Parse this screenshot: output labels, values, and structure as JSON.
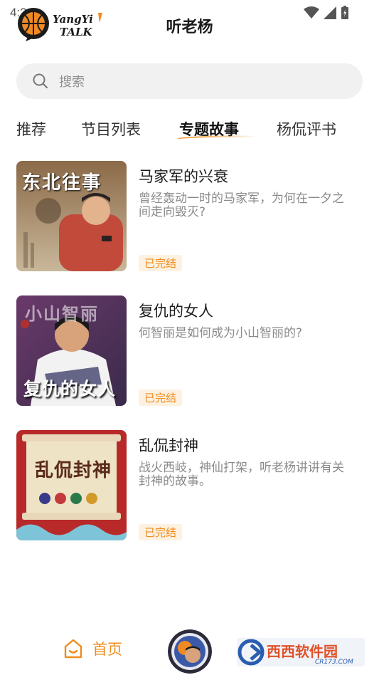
{
  "status_bar": {
    "time": "4:2"
  },
  "header": {
    "logo_text": "YangYi Talk",
    "title": "听老杨"
  },
  "search": {
    "placeholder": "搜索"
  },
  "tabs": [
    {
      "label": "推荐",
      "active": false
    },
    {
      "label": "节目列表",
      "active": false
    },
    {
      "label": "专题故事",
      "active": true
    },
    {
      "label": "杨侃评书",
      "active": false
    }
  ],
  "stories": [
    {
      "cover_text": "东北往事",
      "title": "马家军的兴衰",
      "description": "曾经轰动一时的马家军，为何在一夕之间走向毁灭?",
      "badge": "已完结"
    },
    {
      "cover_text_top": "小山智丽",
      "cover_text": "复仇的女人",
      "title": "复仇的女人",
      "description": "何智丽是如何成为小山智丽的?",
      "badge": "已完结"
    },
    {
      "cover_text": "乱侃封神",
      "title": "乱侃封神",
      "description": "战火西岐，神仙打架，听老杨讲讲有关封神的故事。",
      "badge": "已完结"
    }
  ],
  "bottom_nav": {
    "home_label": "首页",
    "watermark_text": "西西软件园",
    "watermark_sub": "CR173.COM"
  },
  "colors": {
    "accent": "#ef8b1a",
    "badge_bg": "#fdf1e1",
    "search_bg": "#f1f1f1"
  }
}
